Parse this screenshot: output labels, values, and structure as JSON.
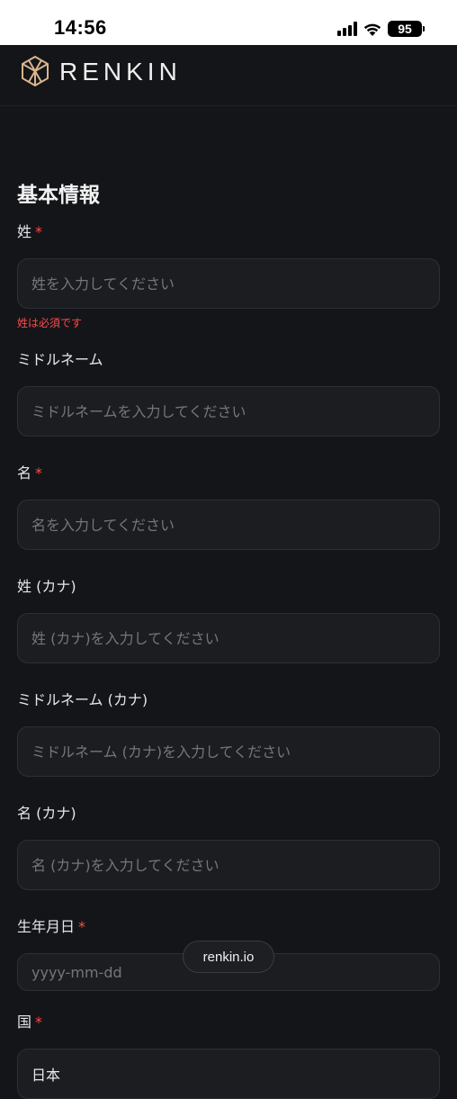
{
  "status_bar": {
    "time": "14:56",
    "battery": "95",
    "icons": [
      "signal-icon",
      "wifi-icon",
      "battery-icon"
    ]
  },
  "header": {
    "logo_icon": "cube-logo-icon",
    "brand": "RENKIN"
  },
  "form": {
    "section_title": "基本情報",
    "required_mark": "*",
    "fields": [
      {
        "label": "姓",
        "required": true,
        "placeholder": "姓を入力してください",
        "value": "",
        "error": "姓は必須です"
      },
      {
        "label": "ミドルネーム",
        "required": false,
        "placeholder": "ミドルネームを入力してください",
        "value": ""
      },
      {
        "label": "名",
        "required": true,
        "placeholder": "名を入力してください",
        "value": ""
      },
      {
        "label": "姓 (カナ)",
        "required": false,
        "placeholder": "姓 (カナ)を入力してください",
        "value": ""
      },
      {
        "label": "ミドルネーム (カナ)",
        "required": false,
        "placeholder": "ミドルネーム (カナ)を入力してください",
        "value": ""
      },
      {
        "label": "名 (カナ)",
        "required": false,
        "placeholder": "名 (カナ)を入力してください",
        "value": ""
      },
      {
        "label": "生年月日",
        "required": true,
        "placeholder": "yyyy-mm-dd",
        "value": ""
      },
      {
        "label": "国",
        "required": true,
        "placeholder": "",
        "value": "日本"
      }
    ]
  },
  "browser": {
    "url": "renkin.io"
  },
  "colors": {
    "background": "#141518",
    "input_background": "#1c1d21",
    "input_border": "#2e2f35",
    "placeholder": "#75767d",
    "required": "#ff4949"
  }
}
